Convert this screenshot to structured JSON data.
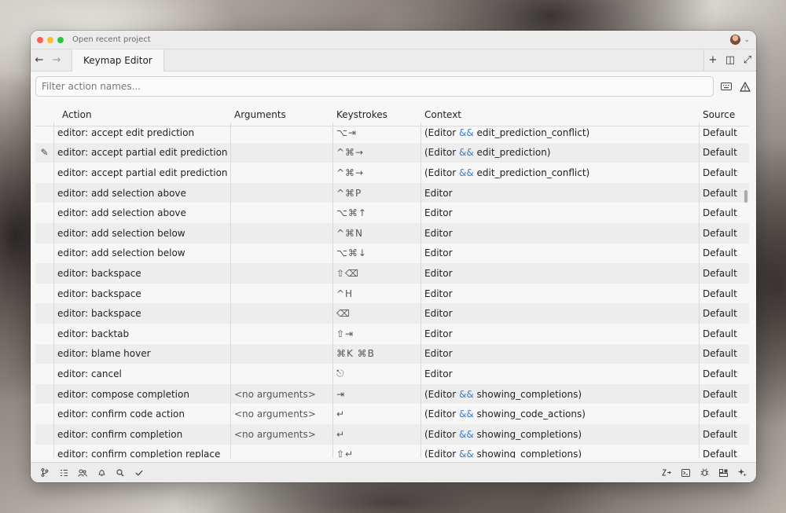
{
  "window": {
    "title": "Open recent project"
  },
  "tabs": [
    {
      "label": "Keymap Editor"
    }
  ],
  "search": {
    "placeholder": "Filter action names..."
  },
  "columns": {
    "action": "Action",
    "arguments": "Arguments",
    "keystrokes": "Keystrokes",
    "context": "Context",
    "source": "Source"
  },
  "rows": [
    {
      "action": "editor: accept edit prediction",
      "args": "",
      "keys": "⌥⇥",
      "ctx_pre": "(Editor ",
      "ctx_amp": "&&",
      "ctx_post": " edit_prediction_conflict)",
      "source": "Default"
    },
    {
      "action": "editor: accept partial edit prediction",
      "args": "",
      "keys": "^⌘→",
      "ctx_pre": "(Editor ",
      "ctx_amp": "&&",
      "ctx_post": " edit_prediction)",
      "source": "Default"
    },
    {
      "action": "editor: accept partial edit prediction",
      "args": "",
      "keys": "^⌘→",
      "ctx_pre": "(Editor ",
      "ctx_amp": "&&",
      "ctx_post": " edit_prediction_conflict)",
      "source": "Default"
    },
    {
      "action": "editor: add selection above",
      "args": "",
      "keys": "^⌘P",
      "ctx_pre": "Editor",
      "ctx_amp": "",
      "ctx_post": "",
      "source": "Default"
    },
    {
      "action": "editor: add selection above",
      "args": "",
      "keys": "⌥⌘↑",
      "ctx_pre": "Editor",
      "ctx_amp": "",
      "ctx_post": "",
      "source": "Default"
    },
    {
      "action": "editor: add selection below",
      "args": "",
      "keys": "^⌘N",
      "ctx_pre": "Editor",
      "ctx_amp": "",
      "ctx_post": "",
      "source": "Default"
    },
    {
      "action": "editor: add selection below",
      "args": "",
      "keys": "⌥⌘↓",
      "ctx_pre": "Editor",
      "ctx_amp": "",
      "ctx_post": "",
      "source": "Default"
    },
    {
      "action": "editor: backspace",
      "args": "",
      "keys": "⇧⌫",
      "ctx_pre": "Editor",
      "ctx_amp": "",
      "ctx_post": "",
      "source": "Default"
    },
    {
      "action": "editor: backspace",
      "args": "",
      "keys": "^H",
      "ctx_pre": "Editor",
      "ctx_amp": "",
      "ctx_post": "",
      "source": "Default"
    },
    {
      "action": "editor: backspace",
      "args": "",
      "keys": "⌫",
      "ctx_pre": "Editor",
      "ctx_amp": "",
      "ctx_post": "",
      "source": "Default"
    },
    {
      "action": "editor: backtab",
      "args": "",
      "keys": "⇧⇥",
      "ctx_pre": "Editor",
      "ctx_amp": "",
      "ctx_post": "",
      "source": "Default"
    },
    {
      "action": "editor: blame hover",
      "args": "",
      "keys": "⌘K ⌘B",
      "ctx_pre": "Editor",
      "ctx_amp": "",
      "ctx_post": "",
      "source": "Default"
    },
    {
      "action": "editor: cancel",
      "args": "",
      "keys": "⎋",
      "ctx_pre": "Editor",
      "ctx_amp": "",
      "ctx_post": "",
      "source": "Default"
    },
    {
      "action": "editor: compose completion",
      "args": "<no arguments>",
      "keys": "⇥",
      "ctx_pre": "(Editor ",
      "ctx_amp": "&&",
      "ctx_post": " showing_completions)",
      "source": "Default"
    },
    {
      "action": "editor: confirm code action",
      "args": "<no arguments>",
      "keys": "↵",
      "ctx_pre": "(Editor ",
      "ctx_amp": "&&",
      "ctx_post": " showing_code_actions)",
      "source": "Default"
    },
    {
      "action": "editor: confirm completion",
      "args": "<no arguments>",
      "keys": "↵",
      "ctx_pre": "(Editor ",
      "ctx_amp": "&&",
      "ctx_post": " showing_completions)",
      "source": "Default"
    },
    {
      "action": "editor: confirm completion replace",
      "args": "",
      "keys": "⇧↵",
      "ctx_pre": "(Editor ",
      "ctx_amp": "&&",
      "ctx_post": " showing_completions)",
      "source": "Default"
    }
  ],
  "icons": {
    "back": "←",
    "forward": "→",
    "plus": "+",
    "split": "◫",
    "expand": "⤢",
    "keyboard": "⌨",
    "warning": "⚠",
    "pencil": "✎"
  }
}
